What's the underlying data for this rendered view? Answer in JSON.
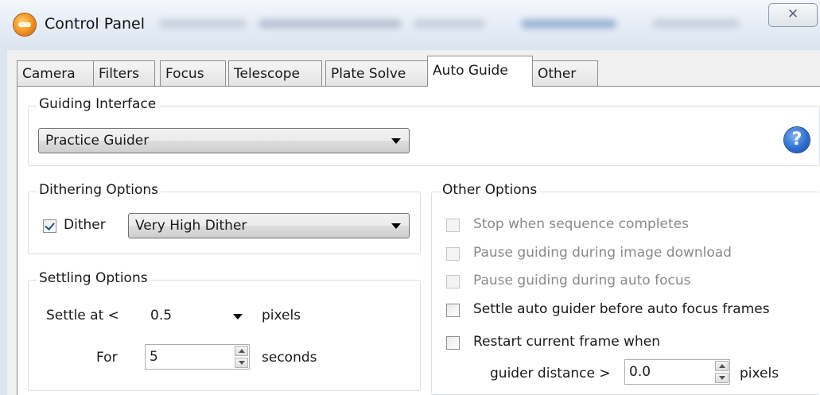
{
  "window": {
    "title": "Control Panel",
    "close_glyph": "✕"
  },
  "tabs": [
    {
      "label": "Camera",
      "active": false
    },
    {
      "label": "Filters",
      "active": false
    },
    {
      "label": "Focus",
      "active": false
    },
    {
      "label": "Telescope",
      "active": false
    },
    {
      "label": "Plate Solve",
      "active": false
    },
    {
      "label": "Auto Guide",
      "active": true
    },
    {
      "label": "Other",
      "active": false
    }
  ],
  "guiding_interface": {
    "legend": "Guiding Interface",
    "selected": "Practice Guider",
    "help_glyph": "?"
  },
  "dithering": {
    "legend": "Dithering Options",
    "dither_label": "Dither",
    "dither_checked": true,
    "level": "Very High Dither"
  },
  "settling": {
    "legend": "Settling Options",
    "settle_label": "Settle at <",
    "settle_value": "0.5",
    "settle_unit": "pixels",
    "for_label": "For",
    "for_value": "5",
    "for_unit": "seconds"
  },
  "other_options": {
    "legend": "Other Options",
    "stop_sequence": {
      "label": "Stop when sequence completes",
      "enabled": false,
      "checked": false
    },
    "pause_download": {
      "label": "Pause guiding during image download",
      "enabled": false,
      "checked": false
    },
    "pause_autofocus": {
      "label": "Pause guiding during auto focus",
      "enabled": false,
      "checked": false
    },
    "settle_before_af": {
      "label": "Settle auto guider before auto focus frames",
      "enabled": true,
      "checked": false
    },
    "restart_frame": {
      "label": "Restart current frame when",
      "enabled": true,
      "checked": false
    },
    "guider_distance_label": "guider distance >",
    "guider_distance_value": "0.0",
    "guider_distance_unit": "pixels"
  }
}
